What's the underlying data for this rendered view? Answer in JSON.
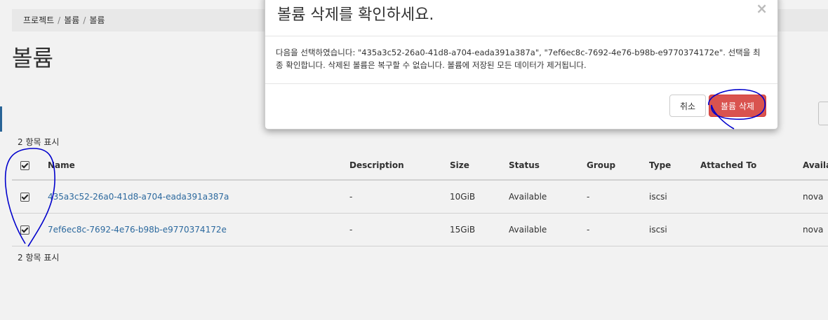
{
  "breadcrumb": {
    "items": [
      "프로젝트",
      "볼륨",
      "볼륨"
    ],
    "separator": "/"
  },
  "page": {
    "title": "볼륨"
  },
  "table": {
    "count_top": "2 항목 표시",
    "count_bottom": "2 항목 표시",
    "headers": [
      "Name",
      "Description",
      "Size",
      "Status",
      "Group",
      "Type",
      "Attached To",
      "Availa"
    ],
    "rows": [
      {
        "name": "435a3c52-26a0-41d8-a704-eada391a387a",
        "description": "-",
        "size": "10GiB",
        "status": "Available",
        "group": "-",
        "type": "iscsi",
        "attached_to": "",
        "availability": "nova"
      },
      {
        "name": "7ef6ec8c-7692-4e76-b98b-e9770374172e",
        "description": "-",
        "size": "15GiB",
        "status": "Available",
        "group": "-",
        "type": "iscsi",
        "attached_to": "",
        "availability": "nova"
      }
    ]
  },
  "modal": {
    "title": "볼륨 삭제를 확인하세요.",
    "close": "×",
    "body": "다음을 선택하였습니다: \"435a3c52-26a0-41d8-a704-eada391a387a\", \"7ef6ec8c-7692-4e76-b98b-e9770374172e\". 선택을 최종 확인합니다. 삭제된 볼륨은 복구할 수 없습니다. 볼륨에 저장된 모든 데이터가 제거됩니다.",
    "cancel_label": "취소",
    "confirm_label": "볼륨 삭제"
  },
  "colors": {
    "danger": "#d9534f",
    "link": "#2f6fa7",
    "annotation": "#0000cc"
  }
}
